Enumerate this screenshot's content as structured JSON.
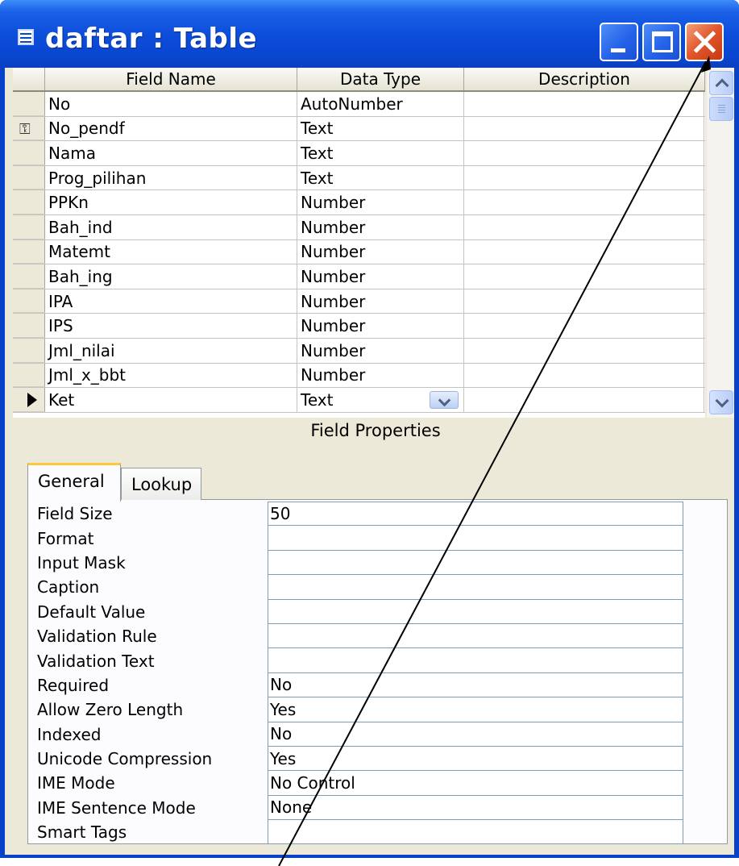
{
  "window": {
    "title": "daftar : Table",
    "controls": [
      "minimize",
      "maximize",
      "close"
    ]
  },
  "grid": {
    "columns": [
      "Field Name",
      "Data Type",
      "Description"
    ],
    "rows": [
      {
        "name": "No",
        "type": "AutoNumber",
        "description": "",
        "marker": ""
      },
      {
        "name": "No_pendf",
        "type": "Text",
        "description": "",
        "marker": "primary-key"
      },
      {
        "name": "Nama",
        "type": "Text",
        "description": "",
        "marker": ""
      },
      {
        "name": "Prog_pilihan",
        "type": "Text",
        "description": "",
        "marker": ""
      },
      {
        "name": "PPKn",
        "type": "Number",
        "description": "",
        "marker": ""
      },
      {
        "name": "Bah_ind",
        "type": "Number",
        "description": "",
        "marker": ""
      },
      {
        "name": "Matemt",
        "type": "Number",
        "description": "",
        "marker": ""
      },
      {
        "name": "Bah_ing",
        "type": "Number",
        "description": "",
        "marker": ""
      },
      {
        "name": "IPA",
        "type": "Number",
        "description": "",
        "marker": ""
      },
      {
        "name": "IPS",
        "type": "Number",
        "description": "",
        "marker": ""
      },
      {
        "name": "Jml_nilai",
        "type": "Number",
        "description": "",
        "marker": ""
      },
      {
        "name": "Jml_x_bbt",
        "type": "Number",
        "description": "",
        "marker": ""
      },
      {
        "name": "Ket",
        "type": "Text",
        "description": "",
        "marker": "current"
      }
    ]
  },
  "field_properties": {
    "title": "Field Properties",
    "tabs": [
      "General",
      "Lookup"
    ],
    "active_tab": "General",
    "properties": [
      {
        "label": "Field Size",
        "value": "50"
      },
      {
        "label": "Format",
        "value": ""
      },
      {
        "label": "Input Mask",
        "value": ""
      },
      {
        "label": "Caption",
        "value": ""
      },
      {
        "label": "Default Value",
        "value": ""
      },
      {
        "label": "Validation Rule",
        "value": ""
      },
      {
        "label": "Validation Text",
        "value": ""
      },
      {
        "label": "Required",
        "value": "No"
      },
      {
        "label": "Allow Zero Length",
        "value": "Yes"
      },
      {
        "label": "Indexed",
        "value": "No"
      },
      {
        "label": "Unicode Compression",
        "value": "Yes"
      },
      {
        "label": "IME Mode",
        "value": "No Control"
      },
      {
        "label": "IME Sentence Mode",
        "value": "None"
      },
      {
        "label": "Smart Tags",
        "value": ""
      }
    ]
  },
  "colors": {
    "titlebar": "#0a46d0",
    "close_button": "#e0552a",
    "client_bg": "#ece9d8",
    "active_tab_accent": "#ffc83c"
  },
  "icons": {
    "title": "table-icon",
    "key": "primary-key-icon",
    "current_row": "current-row-arrow-icon",
    "dropdown": "chevron-down-icon"
  }
}
